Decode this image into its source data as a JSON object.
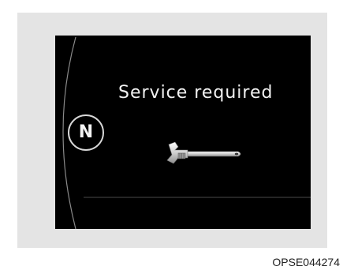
{
  "cluster": {
    "message": "Service required",
    "gear_indicator": "N",
    "wrench_icon": "wrench-icon"
  },
  "figure": {
    "caption": "OPSE044274"
  }
}
